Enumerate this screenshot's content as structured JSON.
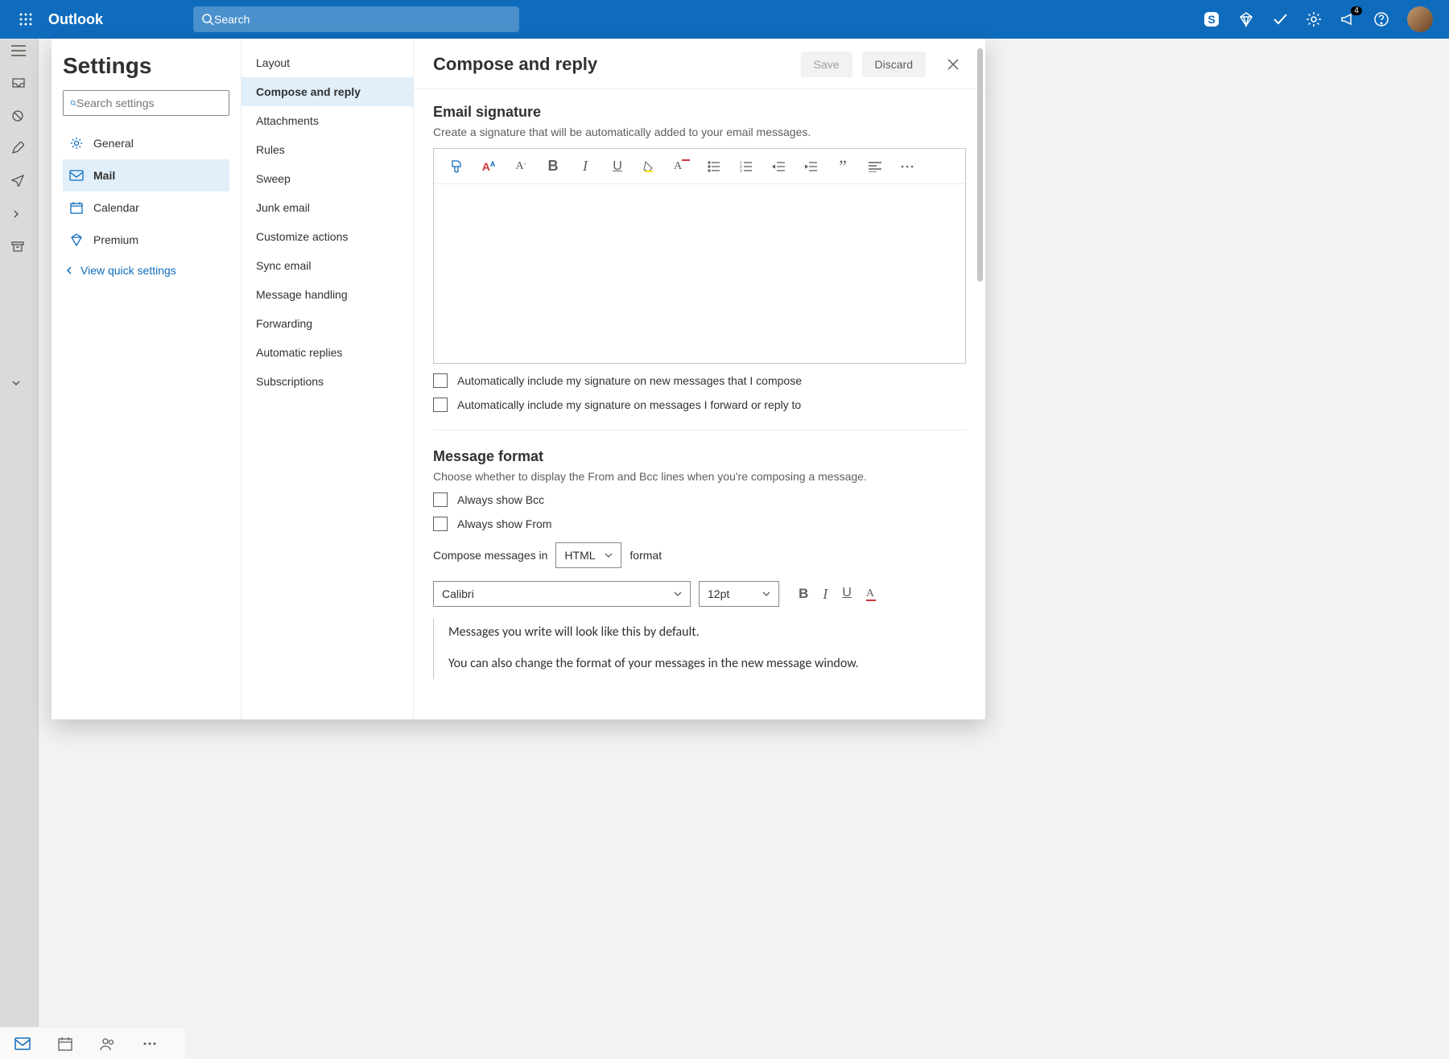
{
  "topbar": {
    "brand": "Outlook",
    "search_placeholder": "Search",
    "notification_count": "4"
  },
  "settings": {
    "title": "Settings",
    "search_placeholder": "Search settings",
    "categories": [
      {
        "icon": "gear",
        "label": "General"
      },
      {
        "icon": "mail",
        "label": "Mail",
        "active": true
      },
      {
        "icon": "calendar",
        "label": "Calendar"
      },
      {
        "icon": "diamond",
        "label": "Premium"
      }
    ],
    "quick_link": "View quick settings"
  },
  "subnav": [
    "Layout",
    "Compose and reply",
    "Attachments",
    "Rules",
    "Sweep",
    "Junk email",
    "Customize actions",
    "Sync email",
    "Message handling",
    "Forwarding",
    "Automatic replies",
    "Subscriptions"
  ],
  "subnav_active": "Compose and reply",
  "panel": {
    "title": "Compose and reply",
    "save": "Save",
    "discard": "Discard",
    "signature": {
      "heading": "Email signature",
      "desc": "Create a signature that will be automatically added to your email messages.",
      "check_new": "Automatically include my signature on new messages that I compose",
      "check_reply": "Automatically include my signature on messages I forward or reply to"
    },
    "format": {
      "heading": "Message format",
      "desc": "Choose whether to display the From and Bcc lines when you're composing a message.",
      "check_bcc": "Always show Bcc",
      "check_from": "Always show From",
      "compose_prefix": "Compose messages in",
      "compose_mode": "HTML",
      "compose_suffix": "format",
      "font": "Calibri",
      "size": "12pt",
      "preview1": "Messages you write will look like this by default.",
      "preview2": "You can also change the format of your messages in the new message window."
    }
  }
}
